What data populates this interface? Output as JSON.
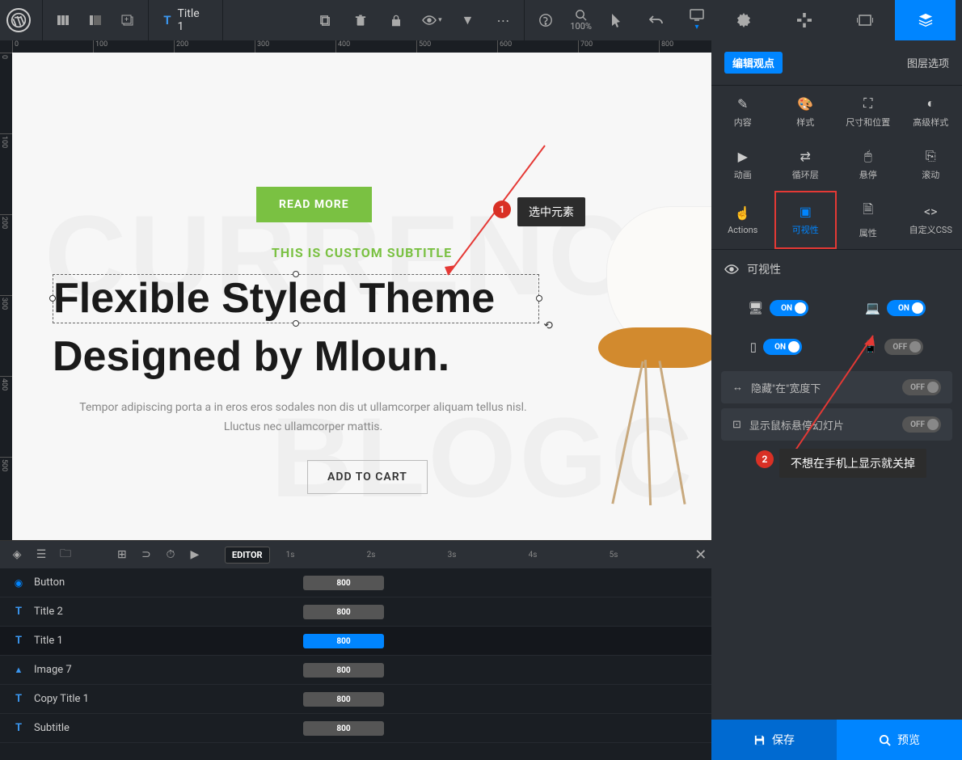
{
  "toolbar": {
    "selected_layer": "Title 1",
    "zoom": "100%"
  },
  "canvas": {
    "read_more": "READ MORE",
    "subtitle": "THIS IS CUSTOM SUBTITLE",
    "title_line1": "Flexible Styled Theme",
    "title_line2": "Designed by Mloun.",
    "description": "Tempor adipiscing porta a in eros eros sodales non dis ut ullamcorper aliquam tellus nisl. Lluctus nec ullamcorper mattis.",
    "cart": "ADD TO CART",
    "ghost1": "CURRENC",
    "ghost2": "BLOGC"
  },
  "annotations": {
    "b1": "1",
    "l1": "选中元素",
    "b2": "2",
    "l2": "不想在手机上显示就关掉"
  },
  "sidebar": {
    "edit_viewpoint": "编辑观点",
    "layer_options": "图层选项",
    "props": {
      "content": "内容",
      "style": "样式",
      "size_pos": "尺寸和位置",
      "adv_style": "高级样式",
      "animation": "动画",
      "loop": "循环层",
      "hover": "悬停",
      "scroll": "滚动",
      "actions": "Actions",
      "visibility": "可视性",
      "attributes": "属性",
      "custom_css": "自定义CSS"
    },
    "section_title": "可视性",
    "toggles": {
      "desktop": "ON",
      "notebook": "ON",
      "tablet": "ON",
      "phone": "OFF"
    },
    "options": {
      "hide_under_width": "隐藏\"在\"宽度下",
      "hide_under_width_state": "OFF",
      "show_hover_slide": "显示鼠标悬停幻灯片",
      "show_hover_slide_state": "OFF"
    }
  },
  "timeline": {
    "editor": "EDITOR",
    "marks": [
      "1s",
      "2s",
      "3s",
      "4s",
      "5s"
    ],
    "rows": [
      {
        "icon": "btn",
        "name": "Button",
        "dur": "800"
      },
      {
        "icon": "txt",
        "name": "Title 2",
        "dur": "800"
      },
      {
        "icon": "txt",
        "name": "Title 1",
        "dur": "800",
        "selected": true
      },
      {
        "icon": "img",
        "name": "Image 7",
        "dur": "800"
      },
      {
        "icon": "txt",
        "name": "Copy Title 1",
        "dur": "800"
      },
      {
        "icon": "txt",
        "name": "Subtitle",
        "dur": "800"
      }
    ]
  },
  "footer": {
    "save": "保存",
    "preview": "预览"
  },
  "ruler_h": [
    "0",
    "100",
    "200",
    "300",
    "400",
    "500",
    "600",
    "700",
    "800"
  ],
  "ruler_v": [
    "0",
    "100",
    "200",
    "300",
    "400",
    "500"
  ]
}
